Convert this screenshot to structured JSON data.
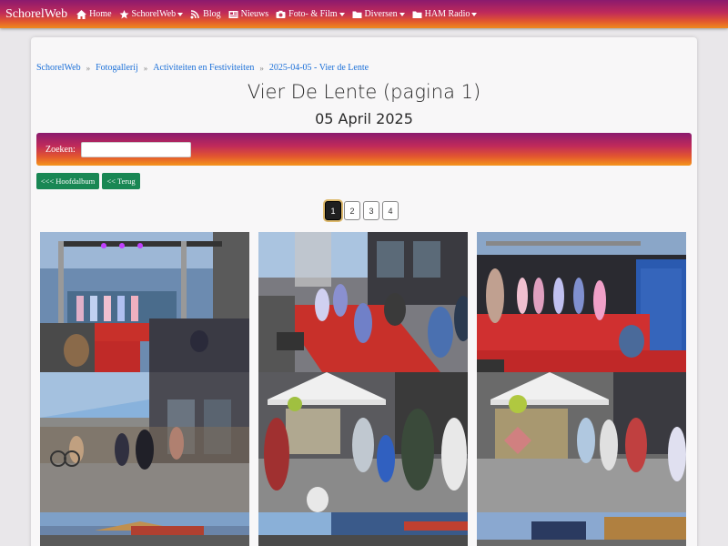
{
  "navbar": {
    "brand": "SchorelWeb",
    "items": [
      {
        "label": "Home",
        "icon": "home-icon",
        "dropdown": false
      },
      {
        "label": "SchorelWeb",
        "icon": "star-icon",
        "dropdown": true
      },
      {
        "label": "Blog",
        "icon": "rss-icon",
        "dropdown": false
      },
      {
        "label": "Nieuws",
        "icon": "newspaper-icon",
        "dropdown": false
      },
      {
        "label": "Foto- & Film",
        "icon": "camera-icon",
        "dropdown": true
      },
      {
        "label": "Diversen",
        "icon": "folder-icon",
        "dropdown": true
      },
      {
        "label": "HAM Radio",
        "icon": "folder-icon",
        "dropdown": true
      }
    ]
  },
  "breadcrumb": [
    "SchorelWeb",
    "Fotogallerij",
    "Activiteiten en Festiviteiten",
    "2025-04-05 - Vier de Lente"
  ],
  "page_title": "Vier De Lente (pagina 1)",
  "page_date": "05 April 2025",
  "search": {
    "label": "Zoeken:",
    "value": ""
  },
  "buttons": {
    "main_album": "<<< Hoofdalbum",
    "back": "<< Terug"
  },
  "pagination": {
    "pages": [
      "1",
      "2",
      "3",
      "4"
    ],
    "current": "1"
  },
  "colors": {
    "brand_gradient_start": "#8a1a6e",
    "brand_gradient_end": "#ef8a1e",
    "button_green": "#198754",
    "link": "#1a6fd8"
  }
}
